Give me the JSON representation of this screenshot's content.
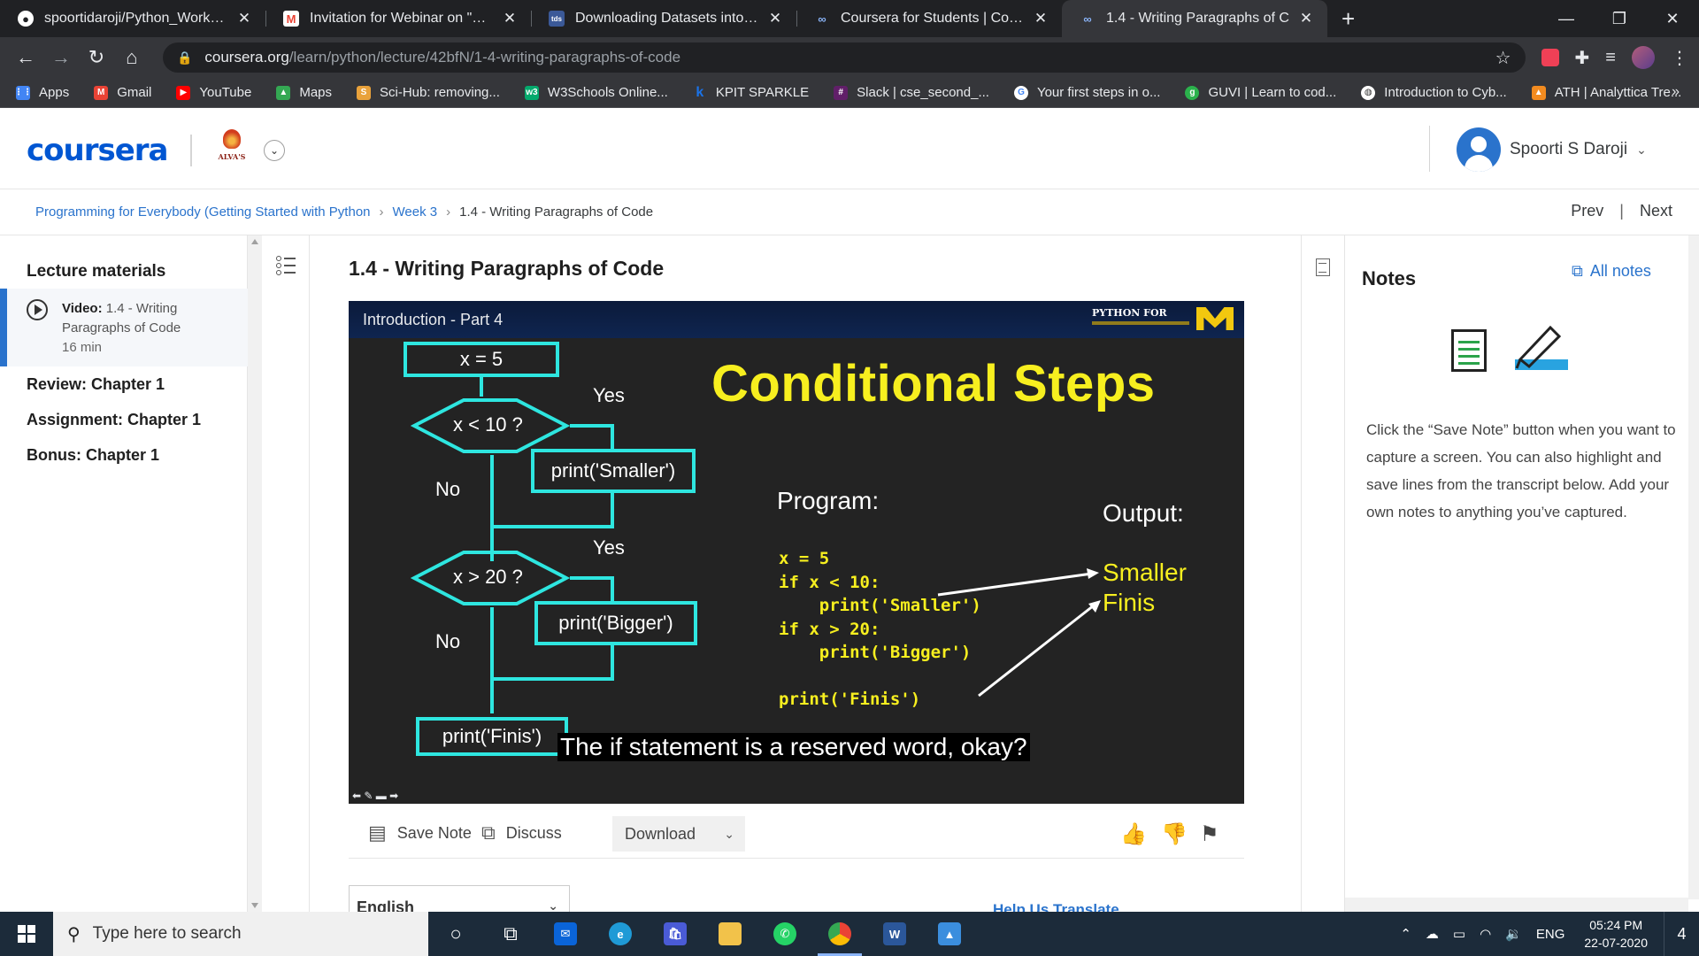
{
  "browser": {
    "tabs": [
      {
        "title": "spoortidaroji/Python_Workshop",
        "icon": "github-icon",
        "active": false
      },
      {
        "title": "Invitation for Webinar on \"Role o",
        "icon": "gmail-icon",
        "active": false
      },
      {
        "title": "Downloading Datasets into Goog",
        "icon": "tds-icon",
        "active": false
      },
      {
        "title": "Coursera for Students | Coursera",
        "icon": "coursera-icon",
        "active": false
      },
      {
        "title": "1.4 - Writing Paragraphs of C",
        "icon": "coursera-icon",
        "active": true
      }
    ],
    "url_host": "coursera.org",
    "url_path": "/learn/python/lecture/42bfN/1-4-writing-paragraphs-of-code",
    "bookmarks": [
      {
        "label": "Apps",
        "color": "#4285f4"
      },
      {
        "label": "Gmail",
        "color": "#ea4335"
      },
      {
        "label": "YouTube",
        "color": "#ff0000"
      },
      {
        "label": "Maps",
        "color": "#34a853"
      },
      {
        "label": "Sci-Hub: removing...",
        "color": "#e9a23b"
      },
      {
        "label": "W3Schools Online...",
        "color": "#04aa6d"
      },
      {
        "label": "KPIT SPARKLE",
        "color": "#1a73e8"
      },
      {
        "label": "Slack | cse_second_...",
        "color": "#611f69"
      },
      {
        "label": "Your first steps in o...",
        "color": "#4285f4"
      },
      {
        "label": "GUVI | Learn to cod...",
        "color": "#2bb24c"
      },
      {
        "label": "Introduction to Cyb...",
        "color": "#5f6368"
      },
      {
        "label": "ATH | Analyttica Tre...",
        "color": "#f28b20"
      }
    ]
  },
  "header": {
    "logo": "coursera",
    "partner_text": "ALVA'S",
    "user_name": "Spoorti S Daroji"
  },
  "breadcrumb": {
    "course": "Programming for Everybody (Getting Started with Python",
    "week": "Week 3",
    "current": "1.4 - Writing Paragraphs of Code",
    "prev": "Prev",
    "next": "Next"
  },
  "sidebar": {
    "title": "Lecture materials",
    "active_item": {
      "type": "Video:",
      "name": "1.4 - Writing Paragraphs of Code",
      "duration": "16 min"
    },
    "items": [
      "Review: Chapter 1",
      "Assignment: Chapter 1",
      "Bonus: Chapter 1"
    ]
  },
  "lecture": {
    "title": "1.4 - Writing Paragraphs of Code",
    "video": {
      "intro": "Introduction - Part 4",
      "brand": "PYTHON FOR",
      "slide_title": "Conditional Steps",
      "flow": {
        "start": "x = 5",
        "cond1": "x < 10 ?",
        "cond2": "x > 20 ?",
        "yes": "Yes",
        "no": "No",
        "act1": "print('Smaller')",
        "act2": "print('Bigger')",
        "end": "print('Finis')"
      },
      "program_label": "Program:",
      "output_label": "Output:",
      "code_lines": [
        "x = 5",
        "if x < 10:",
        "    print('Smaller')",
        "if x > 20:",
        "    print('Bigger')",
        "",
        "print('Finis')"
      ],
      "output_lines": [
        "Smaller",
        "Finis"
      ],
      "caption": "The if statement is a reserved word, okay?"
    },
    "actions": {
      "save_note": "Save Note",
      "discuss": "Discuss",
      "download": "Download"
    },
    "language": "English",
    "help_translate": "Help Us Translate"
  },
  "notes": {
    "title": "Notes",
    "all_notes": "All notes",
    "instructions": "Click the “Save Note” button when you want to capture a screen. You can also highlight and save lines from the transcript below. Add your own notes to anything you’ve captured."
  },
  "taskbar": {
    "search_placeholder": "Type here to search",
    "lang": "ENG",
    "time": "05:24 PM",
    "date": "22-07-2020",
    "notifications": "4"
  }
}
